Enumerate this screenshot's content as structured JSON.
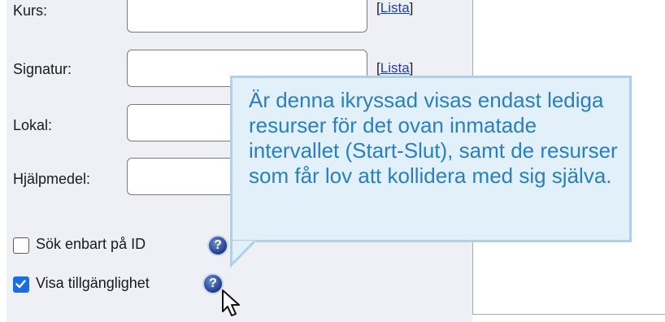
{
  "form": {
    "rows": [
      {
        "label": "Kurs:",
        "lista": "Lista"
      },
      {
        "label": "Signatur:",
        "lista": "Lista"
      },
      {
        "label": "Lokal:"
      },
      {
        "label": "Hjälpmedel:"
      }
    ],
    "lista_open": "[",
    "lista_close": "]"
  },
  "checkboxes": [
    {
      "label": "Sök enbart på ID",
      "checked": false
    },
    {
      "label": "Visa tillgänglighet",
      "checked": true
    }
  ],
  "tooltip": {
    "text": "Är denna ikryssad visas endast lediga resurser för det ovan inmatade intervallet (Start-Slut), samt de resurser som får lov att kollidera med sig själva."
  },
  "icons": {
    "help": "help-circle-icon",
    "checkmark": "checkmark-icon",
    "cursor": "mouse-pointer-icon"
  },
  "colors": {
    "panel_bg": "#eef0f5",
    "tooltip_bg": "#e2f0fa",
    "tooltip_border": "#a9d3ec",
    "tooltip_text": "#2a7fbf",
    "link": "#1d3fb0",
    "checkbox_checked": "#1a6fe0"
  }
}
